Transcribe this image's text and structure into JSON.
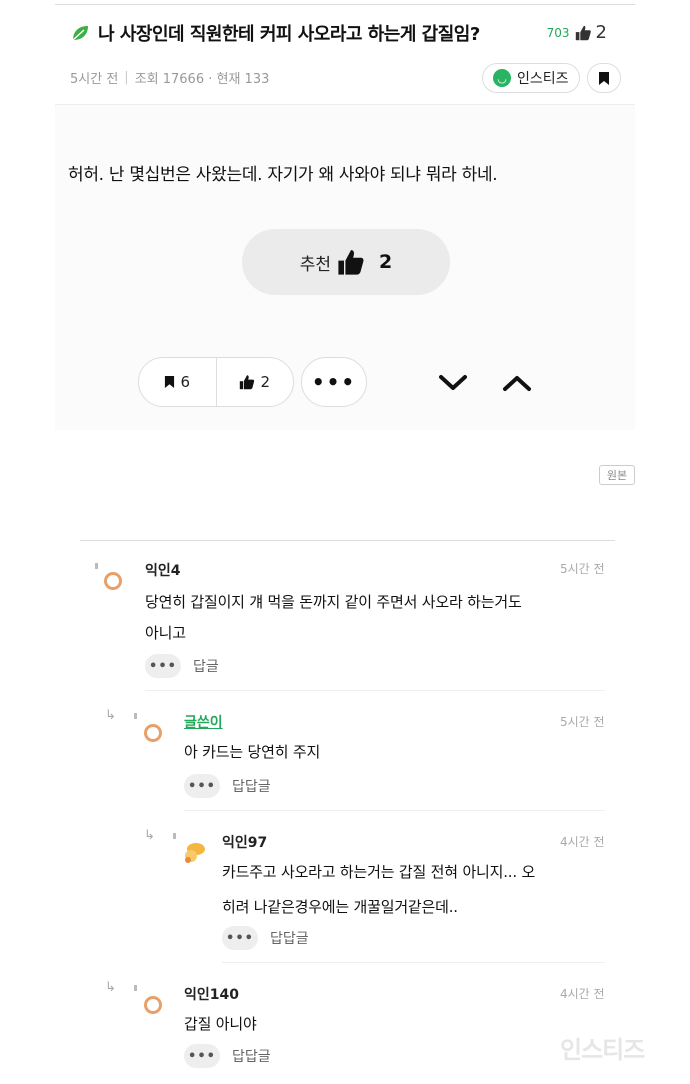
{
  "post": {
    "title": "나 사장인데 직원한테 커피 사오라고 하는게 갑질임?",
    "comment_count": "703",
    "like_count": "2",
    "time_ago": "5시간 전",
    "views": "조회 17666 · 현재 133",
    "source_chip": "인스티즈",
    "body": "허허. 난 몇십번은 사왔는데. 자기가 왜 사와야 되냐 뭐라 하네.",
    "recommend_label": "추천",
    "recommend_count": "2",
    "bookmark_count": "6",
    "like_btn_count": "2",
    "more_label": "•••",
    "original_tag": "원본"
  },
  "comments": [
    {
      "name": "익인4",
      "time": "5시간 전",
      "line1": "당연히 갑질이지 걔 먹을 돈까지 같이 주면서 사오라 하는거도",
      "line2": "아니고",
      "reply": "답글",
      "dots": "•••"
    },
    {
      "name": "글쓴이",
      "time": "5시간 전",
      "line1": "아 카드는 당연히 주지",
      "reply": "답답글",
      "dots": "•••"
    },
    {
      "name": "익인97",
      "time": "4시간 전",
      "line1": "카드주고 사오라고 하는거는 갑질 전혀 아니지... 오",
      "line2": "히려 나같은경우에는 개꿀일거같은데..",
      "reply": "답답글",
      "dots": "•••"
    },
    {
      "name": "익인140",
      "time": "4시간 전",
      "line1": "갑질 아니야",
      "reply": "답답글",
      "dots": "•••"
    }
  ],
  "watermark": "인스티즈",
  "colors": {
    "accent_green": "#26a65b",
    "avatar_ring": "#e8a06a"
  },
  "icons": [
    "leaf-icon",
    "thumbs-up-icon",
    "bookmark-icon",
    "chevron-down-icon",
    "chevron-up-icon",
    "reply-arrow-icon"
  ]
}
